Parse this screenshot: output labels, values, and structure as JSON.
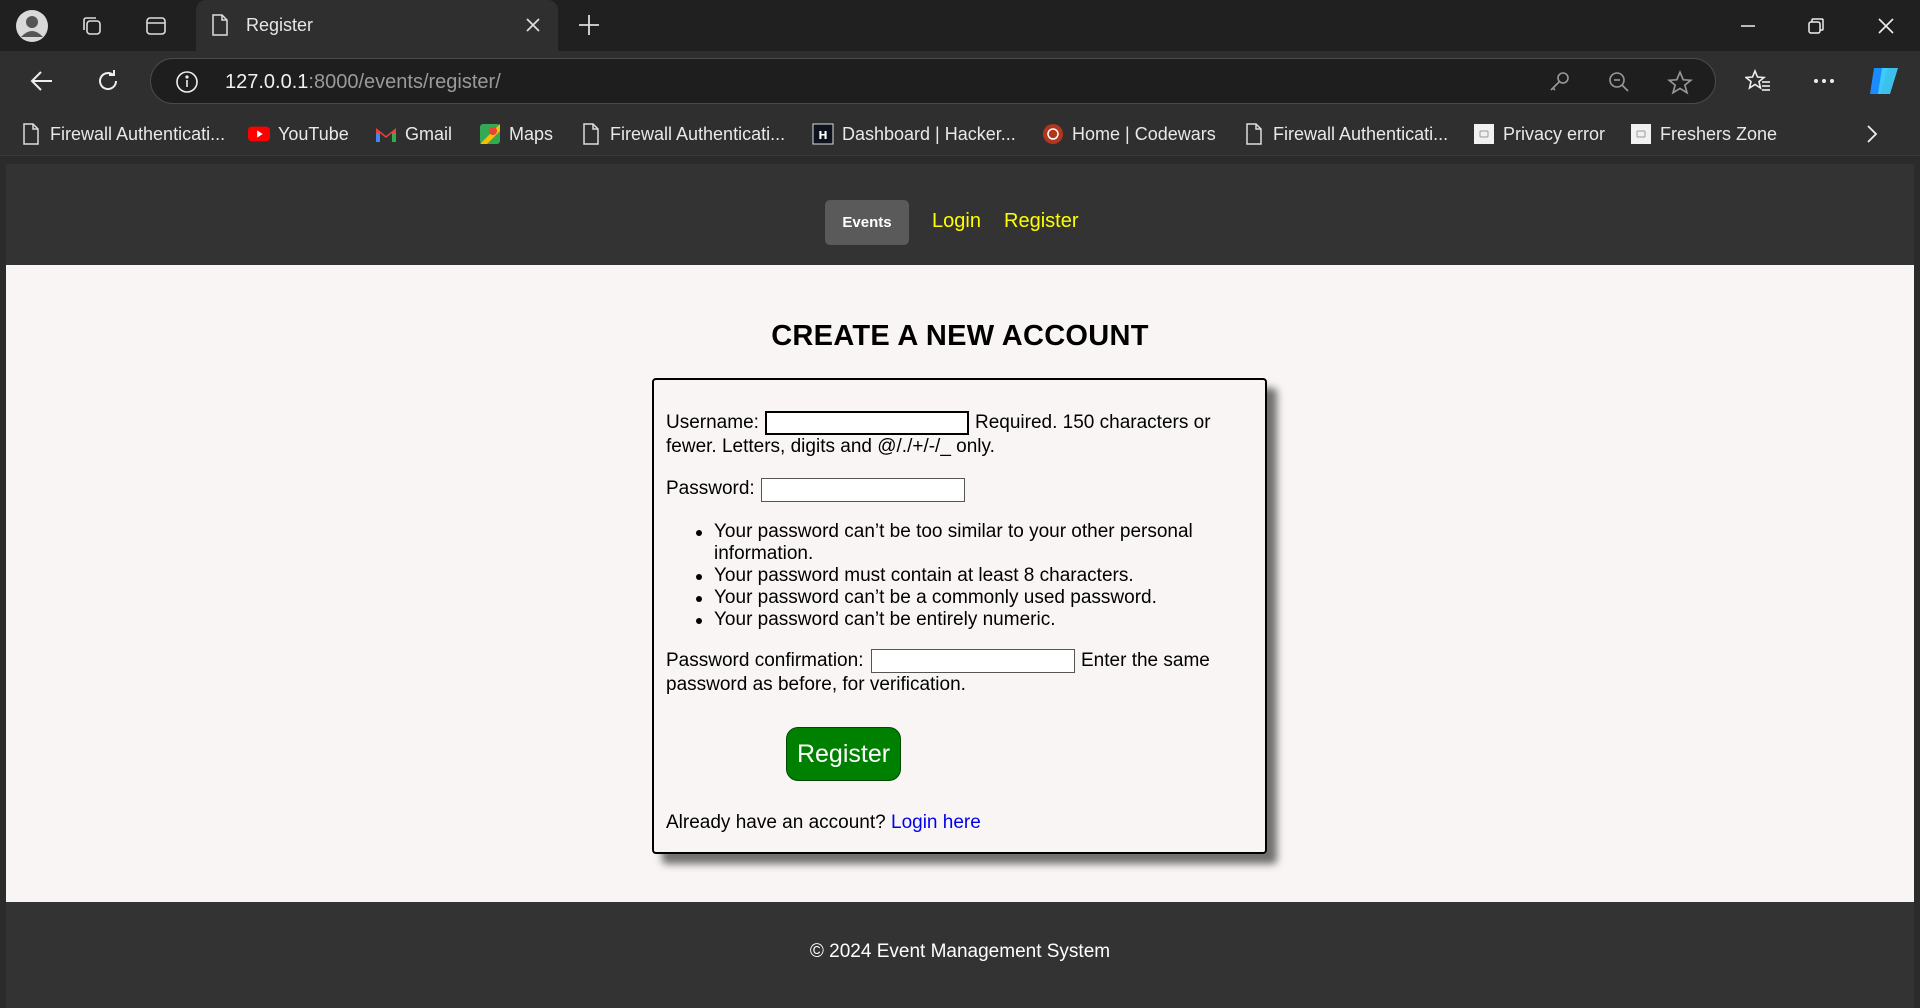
{
  "tab": {
    "title": "Register"
  },
  "address": {
    "host": "127.0.0.1",
    "rest": ":8000/events/register/"
  },
  "bookmarks": [
    {
      "label": "Firewall Authenticati...",
      "icon": "page-icon"
    },
    {
      "label": "YouTube",
      "icon": "youtube-icon"
    },
    {
      "label": "Gmail",
      "icon": "gmail-icon"
    },
    {
      "label": "Maps",
      "icon": "maps-icon"
    },
    {
      "label": "Firewall Authenticati...",
      "icon": "page-icon"
    },
    {
      "label": "Dashboard | Hacker...",
      "icon": "hackerrank-icon"
    },
    {
      "label": "Home | Codewars",
      "icon": "codewars-icon"
    },
    {
      "label": "Firewall Authenticati...",
      "icon": "page-icon"
    },
    {
      "label": "Privacy error",
      "icon": "error-page-icon"
    },
    {
      "label": "Freshers Zone",
      "icon": "site-icon"
    }
  ],
  "nav": {
    "events": "Events",
    "login": "Login",
    "register": "Register"
  },
  "page": {
    "title": "CREATE A NEW ACCOUNT"
  },
  "form": {
    "username_label": "Username:",
    "username_value": "",
    "username_help_1": "Required. 150 characters or",
    "username_help_2": "fewer. Letters, digits and @/./+/-/_ only.",
    "password_label": "Password:",
    "password_value": "",
    "password_rules": [
      "Your password can’t be too similar to your other personal",
      "information.",
      "Your password must contain at least 8 characters.",
      "Your password can’t be a commonly used password.",
      "Your password can’t be entirely numeric."
    ],
    "confirm_label": "Password confirmation:",
    "confirm_value": "",
    "confirm_help_1": "Enter the same",
    "confirm_help_2": "password as before, for verification.",
    "submit": "Register",
    "have_account": "Already have an account?",
    "login_link": "Login here"
  },
  "footer": {
    "text": "© 2024 Event Management System"
  },
  "colors": {
    "nav_link": "#ffff00",
    "button": "#008000",
    "link": "#0000ee",
    "page_bg": "#f9f5f4",
    "header_bg": "#333333"
  }
}
